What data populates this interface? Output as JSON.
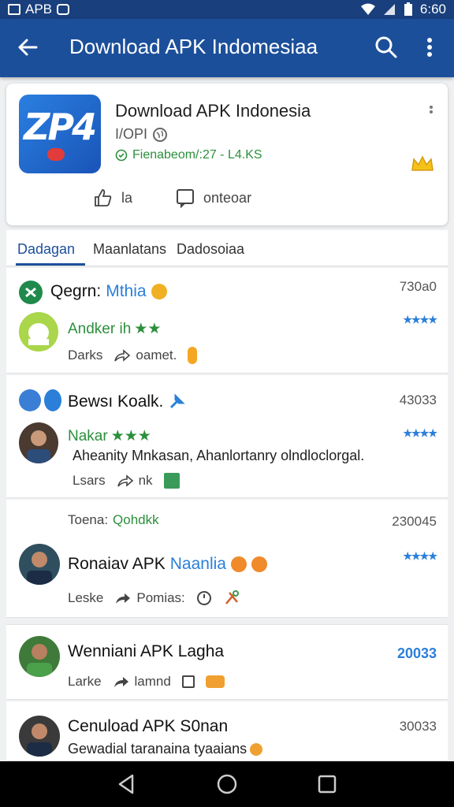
{
  "status_bar": {
    "left_text": "APB",
    "time": "6:60"
  },
  "app_bar": {
    "title": "Download APK Indomesiaa"
  },
  "app_card": {
    "icon_text": "ZP4",
    "name": "Download APK Indonesia",
    "meta": "I/OPI",
    "version": "Fienabeom/:27 - L4.KS",
    "like_label": "la",
    "comment_label": "onteoar"
  },
  "tabs": [
    {
      "label": "Dadagan"
    },
    {
      "label": "Maanlatans"
    },
    {
      "label": "Dadosoiaa"
    }
  ],
  "feed": [
    {
      "title": "Qegrn:",
      "title_accent": "Mthia",
      "count": "730a0",
      "sub": "Andker ih",
      "sub_stars": "★★",
      "stars": "★★★★",
      "action_label": "Darks",
      "share_label": "oamet."
    },
    {
      "title": "Bewsı Koalk.",
      "count": "43033",
      "sub": "Nakar",
      "sub_stars": "★★★",
      "stars": "★★★★",
      "desc": "Aheanity Mnkasan, Ahanlortanry olndloclorgal.",
      "action_label": "Lsars",
      "share_label": "nk"
    },
    {
      "header_label": "Toena:",
      "header_value": "Qohdkk",
      "count": "230045",
      "title": "Ronaiav APK",
      "title_accent": "Naanlia",
      "stars": "★★★★",
      "action_label": "Leske",
      "share_label": "Pomias:"
    },
    {
      "title": "Wenniani APK Lagha",
      "count": "20033",
      "action_label": "Larke",
      "share_label": "lamnd"
    },
    {
      "title": "Cenuload APK S0nan",
      "count": "30033",
      "desc": "Gewadial taranaina tyaaians"
    }
  ],
  "colors": {
    "app_bar": "#1c4f9a",
    "status_bar": "#193f7c",
    "accent": "#2b7fd9",
    "green": "#2c8f3c"
  }
}
